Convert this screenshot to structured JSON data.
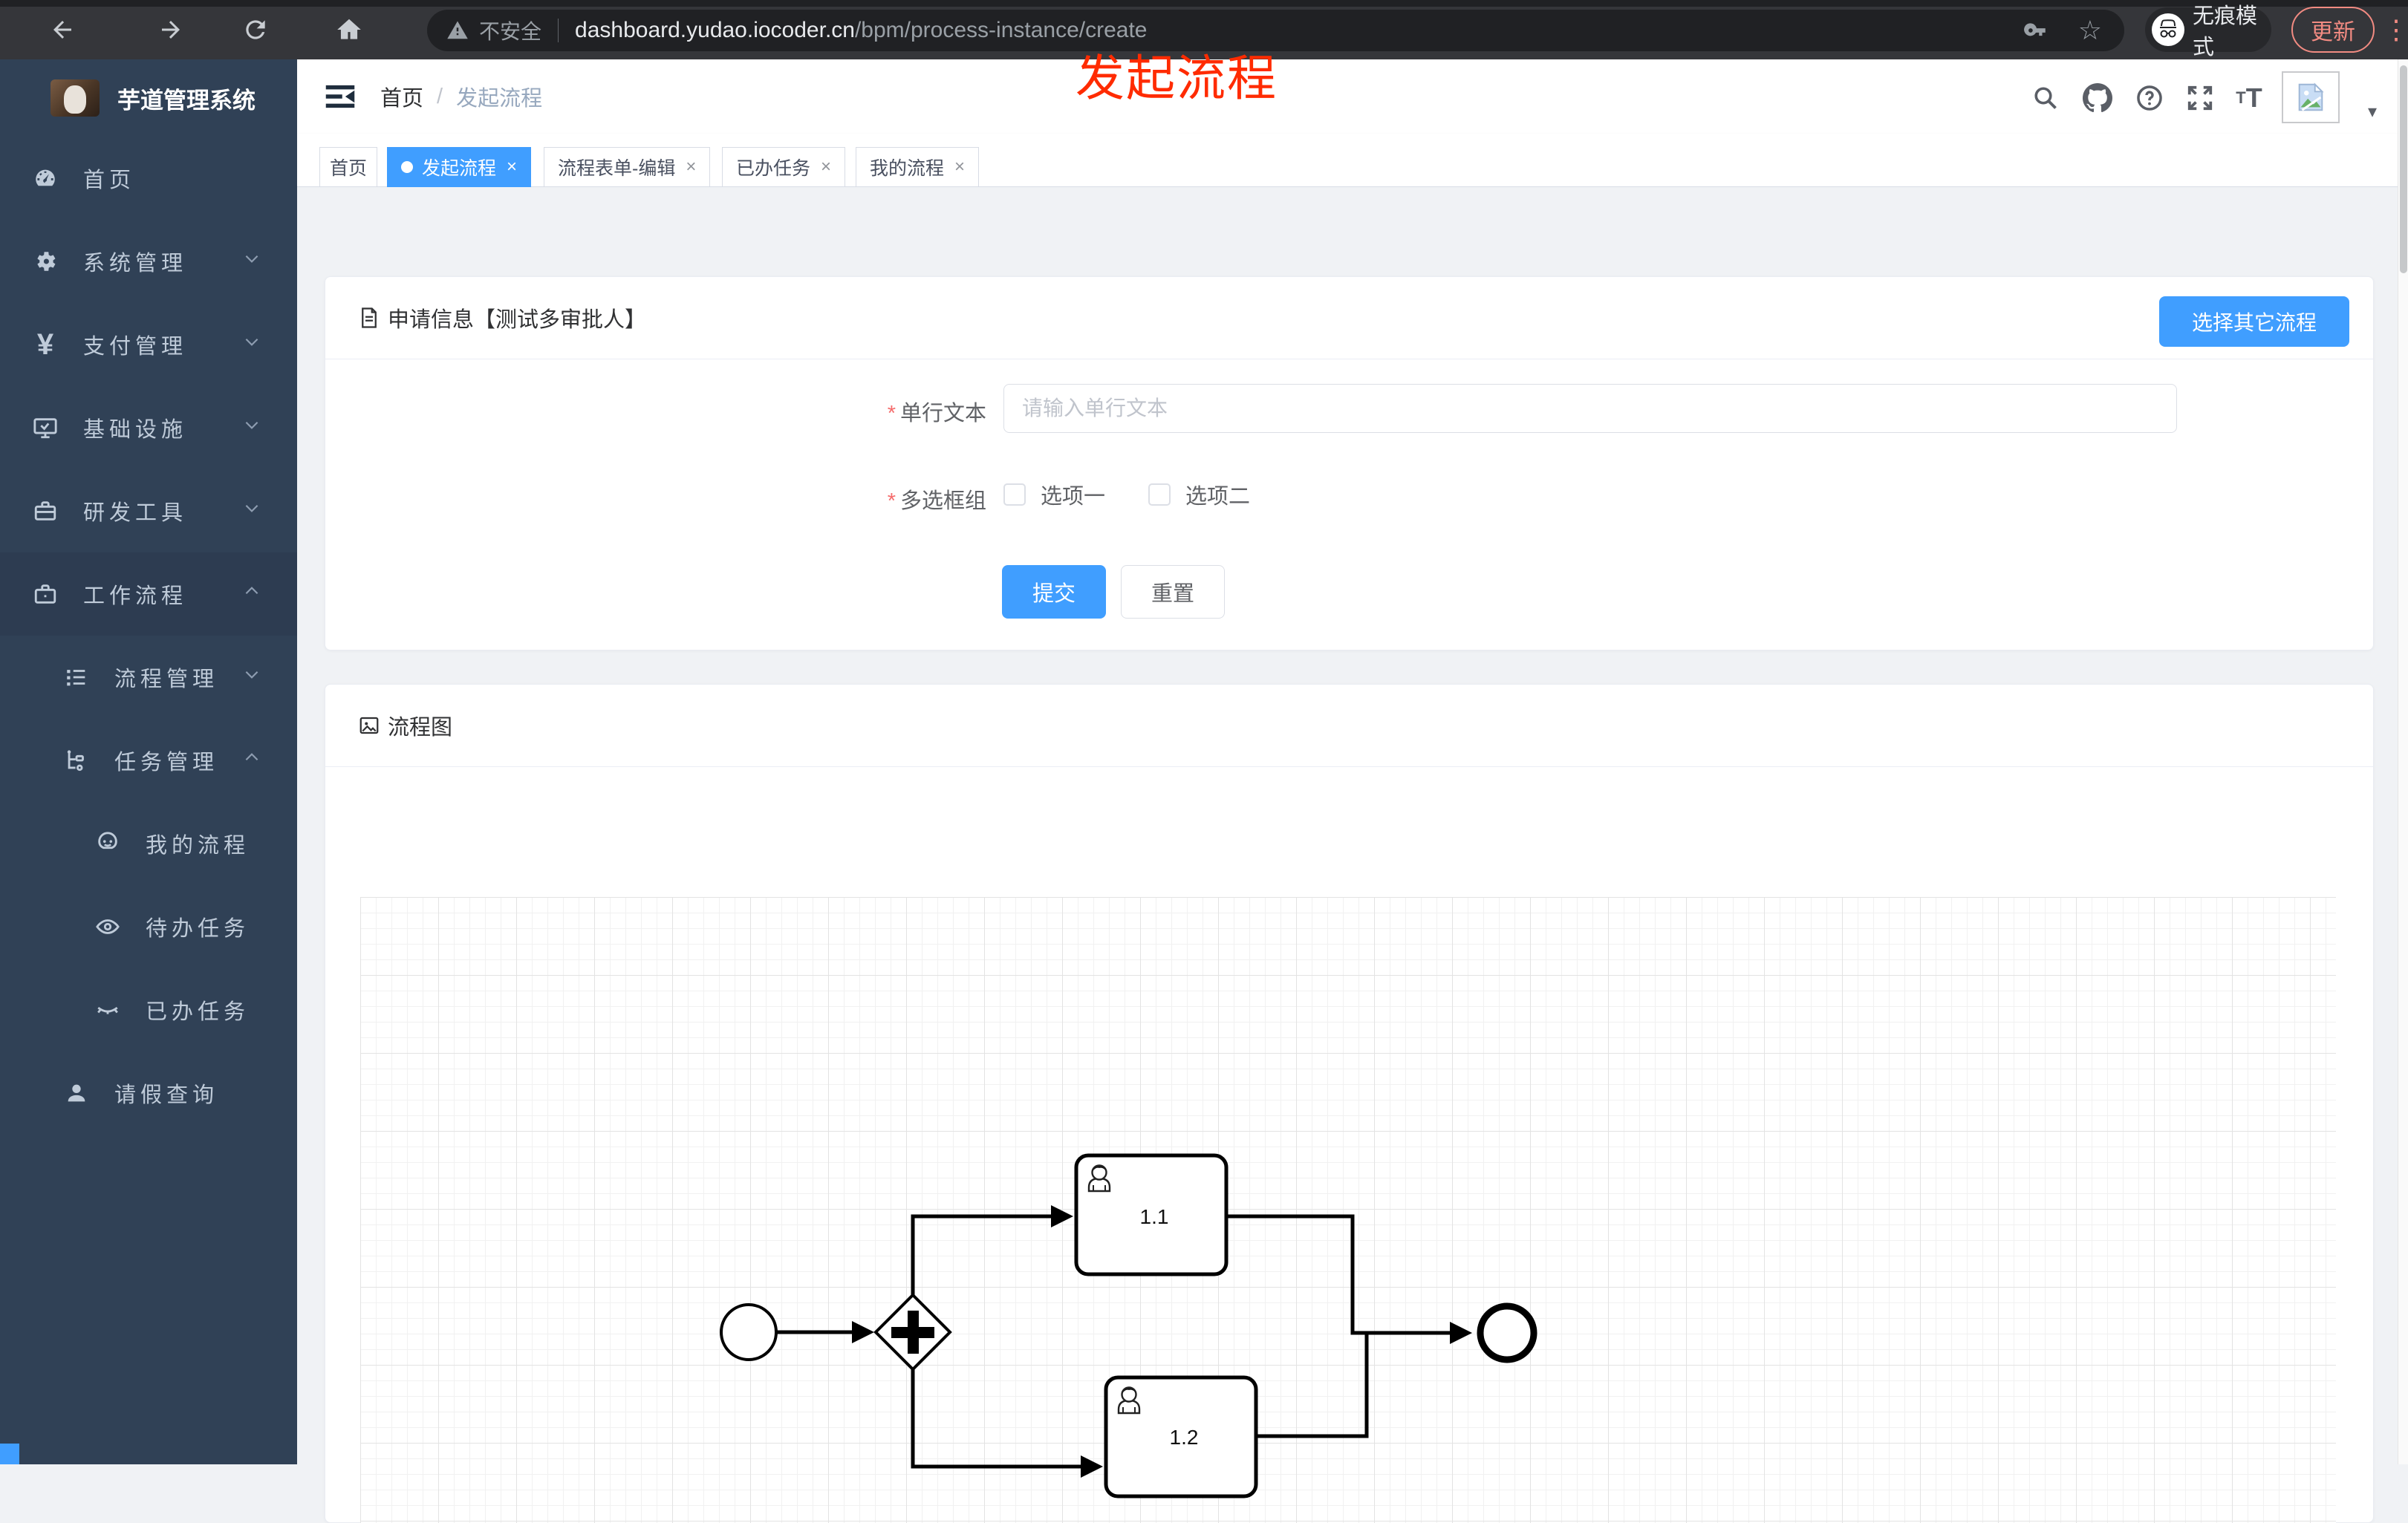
{
  "glyphs": {
    "close": "×",
    "caret": "▾",
    "dots": "⋮",
    "star": "☆",
    "required": "*",
    "help": "?"
  },
  "colors": {
    "primary": "#409eff",
    "sidebar_bg": "#304156",
    "sidebar_text": "#bfcbd9",
    "content_bg": "#f0f2f5",
    "annotation_red": "#ff2b00",
    "salmon": "#f28b82",
    "asterisk": "#f56c6c"
  },
  "browser": {
    "security_label": "不安全",
    "url_domain": "dashboard.yudao.iocoder.cn",
    "url_path": "/bpm/process-instance/create",
    "incognito_label": "无痕模式",
    "update_button": "更新"
  },
  "sidebar": {
    "title": "芋道管理系统",
    "items": [
      {
        "icon": "dashboard-icon",
        "label": "首页",
        "level": 1,
        "chevron": ""
      },
      {
        "icon": "gear-icon",
        "label": "系统管理",
        "level": 1,
        "chevron": "down"
      },
      {
        "icon": "yen-icon",
        "label": "支付管理",
        "level": 1,
        "chevron": "down"
      },
      {
        "icon": "monitor-icon",
        "label": "基础设施",
        "level": 1,
        "chevron": "down"
      },
      {
        "icon": "toolbox-icon",
        "label": "研发工具",
        "level": 1,
        "chevron": "down"
      },
      {
        "icon": "briefcase-icon",
        "label": "工作流程",
        "level": 1,
        "chevron": "up"
      },
      {
        "icon": "list-tree-icon",
        "label": "流程管理",
        "level": 2,
        "chevron": "down"
      },
      {
        "icon": "org-tree-icon",
        "label": "任务管理",
        "level": 2,
        "chevron": "up"
      },
      {
        "icon": "face-icon",
        "label": "我的流程",
        "level": 3,
        "chevron": ""
      },
      {
        "icon": "eye-icon",
        "label": "待办任务",
        "level": 3,
        "chevron": ""
      },
      {
        "icon": "eye-closed-icon",
        "label": "已办任务",
        "level": 3,
        "chevron": ""
      },
      {
        "icon": "user-icon",
        "label": "请假查询",
        "level": 2,
        "chevron": ""
      }
    ]
  },
  "breadcrumb": {
    "first": "首页",
    "separator": "/",
    "current": "发起流程"
  },
  "tabs": {
    "items": [
      {
        "label": "首页",
        "active": false,
        "closable": false
      },
      {
        "label": "发起流程",
        "active": true,
        "closable": true
      },
      {
        "label": "流程表单-编辑",
        "active": false,
        "closable": true
      },
      {
        "label": "已办任务",
        "active": false,
        "closable": true
      },
      {
        "label": "我的流程",
        "active": false,
        "closable": true
      }
    ]
  },
  "annotation": {
    "text": "发起流程"
  },
  "form_card": {
    "title": "申请信息【测试多审批人】",
    "select_other_button": "选择其它流程",
    "text_field": {
      "label": "单行文本",
      "placeholder": "请输入单行文本",
      "value": ""
    },
    "checkbox_field": {
      "label": "多选框组",
      "options": [
        {
          "label": "选项一",
          "checked": false
        },
        {
          "label": "选项二",
          "checked": false
        }
      ]
    },
    "submit_label": "提交",
    "reset_label": "重置"
  },
  "flow_card": {
    "title": "流程图",
    "diagram": {
      "type": "bpmn",
      "nodes": [
        {
          "id": "start",
          "type": "startEvent"
        },
        {
          "id": "gateway",
          "type": "parallelGateway"
        },
        {
          "id": "task1",
          "type": "userTask",
          "label": "1.1"
        },
        {
          "id": "task2",
          "type": "userTask",
          "label": "1.2"
        },
        {
          "id": "end",
          "type": "endEvent"
        }
      ],
      "flows": [
        "start→gateway",
        "gateway→task1",
        "gateway→task2",
        "task1→end",
        "task2→end"
      ]
    }
  }
}
